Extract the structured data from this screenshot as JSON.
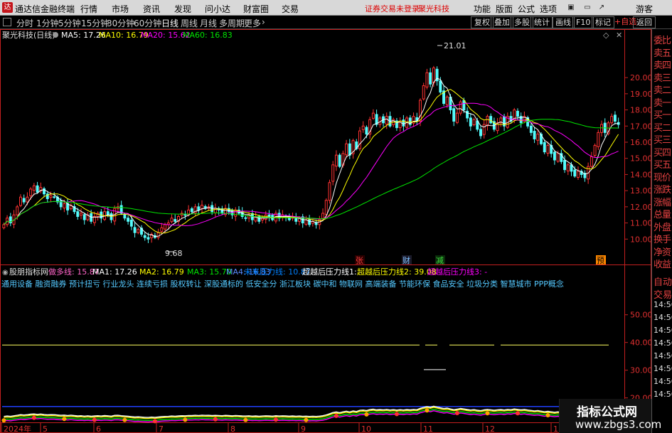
{
  "app": {
    "name": "通达信金融终端",
    "menus": [
      "行情",
      "市场",
      "资讯",
      "发现",
      "问小达",
      "财富圈",
      "交易"
    ],
    "warning": "证券交易未登录",
    "stock_title": "聚光科技",
    "right_menus": [
      "功能",
      "版面",
      "公式",
      "选项"
    ],
    "guest": "游客"
  },
  "toolbar": {
    "periods": [
      "分时",
      "1分钟",
      "5分钟",
      "15分钟",
      "30分钟",
      "60分钟",
      "日线",
      "周线",
      "月线",
      "多周期",
      "更多"
    ],
    "active_period": "日线",
    "right_buttons": [
      "复权",
      "叠加",
      "多股",
      "统计",
      "画线",
      "F10",
      "标记",
      "+自选",
      "返回"
    ]
  },
  "legend_main": {
    "stock": "聚光科技(日线)",
    "ma5": "MA5: 17.26",
    "ma10": "MA10: 16.79",
    "ma20": "MA20: 15.62",
    "ma60": "MA60: 16.83"
  },
  "colors": {
    "up": "#ff3232",
    "down": "#54fcfc",
    "ma5": "#ffffff",
    "ma10": "#ffff00",
    "ma20": "#ff00ff",
    "ma60": "#00e600",
    "axis": "#c41f1f"
  },
  "chart_data": {
    "type": "candlestick",
    "y_axis": [
      20.0,
      19.0,
      18.0,
      17.0,
      16.0,
      15.0,
      14.0,
      13.0,
      12.0,
      11.0,
      10.0
    ],
    "y_labels": [
      "20.00",
      "19.00",
      "18.00",
      "17.00",
      "16.00",
      "15.00",
      "14.00",
      "13.00",
      "12.00",
      "11.00",
      "10.00"
    ],
    "ylim": [
      9.0,
      21.9
    ],
    "high_label": "21.01",
    "low_label": "9.68",
    "x_labels": [
      "2024年",
      "5",
      "6",
      "7",
      "8",
      "9",
      "10",
      "11",
      "12",
      "1"
    ],
    "event_markers": [
      "张",
      "财",
      "减",
      "预"
    ],
    "closes": [
      10.9,
      11.3,
      11.0,
      11.5,
      12.0,
      12.6,
      12.3,
      12.6,
      13.1,
      13.3,
      12.9,
      13.2,
      12.8,
      12.5,
      12.7,
      12.6,
      12.3,
      12.0,
      12.2,
      11.8,
      12.1,
      11.7,
      11.4,
      11.6,
      11.2,
      11.5,
      11.1,
      11.4,
      11.6,
      11.3,
      11.7,
      11.5,
      11.2,
      11.9,
      12.0,
      11.6,
      11.3,
      11.1,
      10.8,
      10.4,
      10.6,
      10.3,
      10.1,
      10.0,
      10.3,
      10.1,
      10.4,
      10.7,
      10.9,
      11.0,
      11.3,
      11.1,
      11.4,
      11.6,
      11.5,
      11.8,
      11.7,
      12.0,
      11.8,
      12.1,
      11.9,
      12.0,
      11.7,
      11.9,
      11.8,
      11.6,
      11.9,
      11.7,
      11.5,
      11.8,
      11.6,
      11.4,
      11.3,
      11.5,
      11.2,
      11.4,
      11.1,
      11.3,
      11.5,
      11.4,
      11.2,
      11.6,
      11.3,
      11.5,
      11.4,
      11.2,
      11.4,
      11.1,
      11.3,
      11.0,
      11.2,
      10.9,
      11.1,
      10.9,
      11.2,
      11.6,
      12.4,
      13.5,
      14.6,
      15.2,
      14.5,
      15.3,
      15.9,
      15.2,
      16.1,
      15.6,
      16.7,
      17.0,
      16.5,
      17.4,
      17.8,
      17.1,
      17.5,
      17.2,
      17.6,
      17.0,
      17.4,
      16.9,
      17.3,
      17.0,
      17.5,
      17.1,
      17.6,
      17.3,
      18.6,
      19.5,
      20.3,
      19.6,
      20.6,
      19.8,
      19.1,
      18.4,
      18.8,
      18.0,
      17.3,
      17.8,
      18.5,
      18.0,
      17.5,
      17.0,
      17.4,
      16.8,
      16.4,
      17.1,
      17.6,
      17.2,
      16.8,
      17.2,
      17.5,
      17.0,
      17.6,
      17.3,
      18.0,
      17.6,
      17.2,
      17.6,
      17.0,
      16.6,
      16.2,
      16.5,
      15.9,
      15.4,
      15.8,
      15.3,
      14.9,
      15.3,
      14.8,
      14.3,
      14.6,
      14.2,
      13.9,
      14.2,
      14.0,
      13.8,
      14.5,
      15.1,
      15.8,
      16.6,
      17.1,
      16.6,
      17.2,
      17.6,
      17.3,
      17.1
    ]
  },
  "legend_sub": {
    "name": "股朋指标网",
    "items": [
      "做多线: 15.87",
      "MA1: 17.26",
      "MA2: 16.79",
      "MA3: 15.70",
      "MA4: 16.83",
      "未来压力线: 10.87",
      "超越后压力线1: -",
      "超越后压力线2: 39.08",
      "超越后压力线3: -"
    ],
    "item_colors": [
      "#ff64c8",
      "#ffffff",
      "#ffff00",
      "#00e600",
      "#5a8cff",
      "#0080ff",
      "#ffffff",
      "#ffff00",
      "#ff00ff"
    ],
    "concepts": "通用设备 融资融券 预计扭亏 行业龙头 连续亏损 股权转让 深股通标的 低安全分 浙江板块 碳中和 物联网 高端装备 节能环保 食品安全 垃圾分类 智慧城市 PPP概念",
    "y_labels": [
      "50.00",
      "40.00",
      "30.00",
      "20.00"
    ]
  },
  "sidebar": {
    "items": [
      "委比",
      "卖五",
      "卖四",
      "卖三",
      "卖二",
      "卖一",
      "买一",
      "买二",
      "买三",
      "买四",
      "买五",
      "现价",
      "涨跌",
      "涨幅",
      "总量",
      "外盘",
      "换手",
      "净资",
      "收益"
    ],
    "items2": [
      "自动",
      "交易",
      "14:56",
      "14:56",
      "14:56",
      "14:56",
      "14:56",
      "14:56",
      "14:56",
      "14:56"
    ]
  },
  "watermark": {
    "line1": "指标公式网",
    "line2": "www.zbgs3.com"
  }
}
